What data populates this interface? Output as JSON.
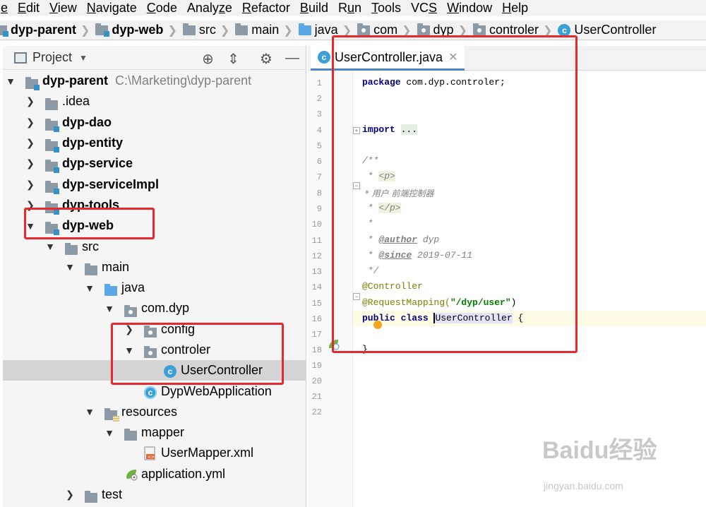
{
  "menubar": {
    "items": [
      {
        "label": "File",
        "mnemonic": "e"
      },
      {
        "label": "Edit",
        "mnemonic": "E"
      },
      {
        "label": "View",
        "mnemonic": "V"
      },
      {
        "label": "Navigate",
        "mnemonic": "N"
      },
      {
        "label": "Code",
        "mnemonic": "C"
      },
      {
        "label": "Analyze",
        "mnemonic": "z"
      },
      {
        "label": "Refactor",
        "mnemonic": "R"
      },
      {
        "label": "Build",
        "mnemonic": "B"
      },
      {
        "label": "Run",
        "mnemonic": "u"
      },
      {
        "label": "Tools",
        "mnemonic": "T"
      },
      {
        "label": "VCS",
        "mnemonic": "S"
      },
      {
        "label": "Window",
        "mnemonic": "W"
      },
      {
        "label": "Help",
        "mnemonic": "H"
      }
    ]
  },
  "breadcrumb": [
    "dyp-parent",
    "dyp-web",
    "src",
    "main",
    "java",
    "com",
    "dyp",
    "controler",
    "UserController"
  ],
  "project_panel": {
    "title": "Project",
    "root_label": "dyp-parent",
    "root_path": "C:\\Marketing\\dyp-parent",
    "items": [
      {
        "label": ".idea"
      },
      {
        "label": "dyp-dao"
      },
      {
        "label": "dyp-entity"
      },
      {
        "label": "dyp-service"
      },
      {
        "label": "dyp-serviceImpl"
      },
      {
        "label": "dyp-tools"
      },
      {
        "label": "dyp-web"
      },
      {
        "label": "src"
      },
      {
        "label": "main"
      },
      {
        "label": "java"
      },
      {
        "label": "com.dyp"
      },
      {
        "label": "config"
      },
      {
        "label": "controler"
      },
      {
        "label": "UserController"
      },
      {
        "label": "DypWebApplication"
      },
      {
        "label": "resources"
      },
      {
        "label": "mapper"
      },
      {
        "label": "UserMapper.xml"
      },
      {
        "label": "application.yml"
      },
      {
        "label": "test"
      }
    ]
  },
  "editor": {
    "tab_label": "UserController.java",
    "line_numbers": [
      "1",
      "2",
      "3",
      "4",
      "5",
      "6",
      "7",
      "8",
      "9",
      "10",
      "11",
      "12",
      "13",
      "14",
      "15",
      "16",
      "17",
      "18",
      "19",
      "20",
      "21",
      "22"
    ],
    "code": {
      "l1_kw": "package",
      "l1_rest": " com.dyp.controler;",
      "l4_kw": "import",
      "l4_dots": "...",
      "l8": "/**",
      "l9_star": " * ",
      "l9_tag": "<p>",
      "l10": " * 用户 前端控制器",
      "l11_star": " * ",
      "l11_tag": "</p>",
      "l12": " *",
      "l13_star": " * ",
      "l13_tag": "@author",
      "l13_val": " dyp",
      "l14_star": " * ",
      "l14_tag": "@since",
      "l14_val": " 2019-07-11",
      "l15": " */",
      "l16": "@Controller",
      "l17_ann": "@RequestMapping(",
      "l17_str": "\"/dyp/user\"",
      "l17_end": ")",
      "l18_kw": "public class",
      "l18_name": "UserController",
      "l18_end": " {",
      "l20": "}"
    }
  },
  "watermark": {
    "brand": "Baidu经验",
    "site": "jingyan.baidu.com"
  }
}
